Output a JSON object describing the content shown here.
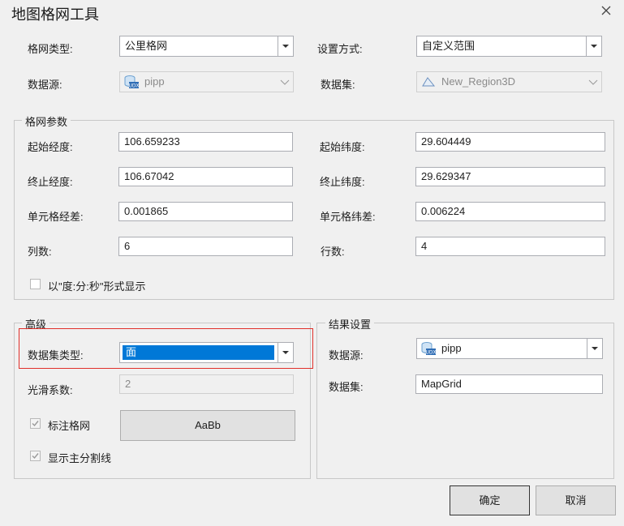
{
  "window": {
    "title": "地图格网工具"
  },
  "top": {
    "grid_type_label": "格网类型:",
    "grid_type_value": "公里格网",
    "setting_method_label": "设置方式:",
    "setting_method_value": "自定义范围",
    "datasource_label": "数据源:",
    "datasource_value": "pipp",
    "dataset_label": "数据集:",
    "dataset_value": "New_Region3D"
  },
  "params": {
    "group_title": "格网参数",
    "start_lon_label": "起始经度:",
    "start_lon_value": "106.659233",
    "start_lat_label": "起始纬度:",
    "start_lat_value": "29.604449",
    "end_lon_label": "终止经度:",
    "end_lon_value": "106.67042",
    "end_lat_label": "终止纬度:",
    "end_lat_value": "29.629347",
    "cell_lon_label": "单元格经差:",
    "cell_lon_value": "0.001865",
    "cell_lat_label": "单元格纬差:",
    "cell_lat_value": "0.006224",
    "cols_label": "列数:",
    "cols_value": "6",
    "rows_label": "行数:",
    "rows_value": "4",
    "dms_label": "以\"度:分:秒\"形式显示",
    "dms_checked": false
  },
  "advanced": {
    "group_title": "高级",
    "dataset_type_label": "数据集类型:",
    "dataset_type_value": "面",
    "smooth_label": "光滑系数:",
    "smooth_value": "2",
    "annotate_label": "标注格网",
    "annotate_checked": true,
    "font_preview": "AaBb",
    "major_lines_label": "显示主分割线",
    "major_lines_checked": true
  },
  "result": {
    "group_title": "结果设置",
    "datasource_label": "数据源:",
    "datasource_value": "pipp",
    "dataset_label": "数据集:",
    "dataset_value": "MapGrid"
  },
  "buttons": {
    "ok": "确定",
    "cancel": "取消"
  },
  "colors": {
    "accent": "#0078d7",
    "highlight_border": "#e0302a"
  }
}
